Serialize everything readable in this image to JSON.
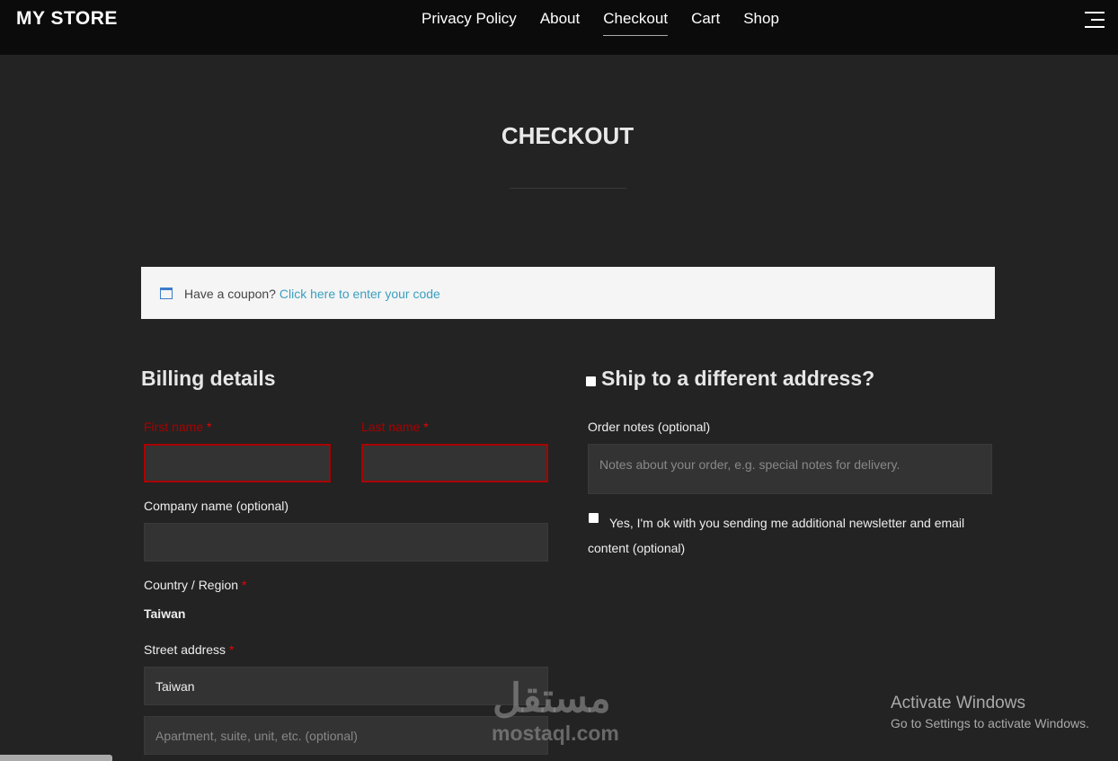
{
  "header": {
    "logo": "MY STORE",
    "nav": [
      "Privacy Policy",
      "About",
      "Checkout",
      "Cart",
      "Shop"
    ],
    "active": "Checkout"
  },
  "page_title": "CHECKOUT",
  "coupon": {
    "text": "Have a coupon?",
    "link": "Click here to enter your code"
  },
  "billing": {
    "title": "Billing details",
    "first_name": "First name",
    "last_name": "Last name",
    "required_mark": "*",
    "company": "Company name (optional)",
    "country_label": "Country / Region",
    "country_value": "Taiwan",
    "street_label": "Street address",
    "street_value": "Taiwan",
    "street2_placeholder": "Apartment, suite, unit, etc. (optional)"
  },
  "shipping": {
    "title": "Ship to a different address?",
    "notes_label": "Order notes (optional)",
    "notes_placeholder": "Notes about your order, e.g. special notes for delivery.",
    "newsletter": "Yes, I'm ok with you sending me additional newsletter and email content (optional)"
  },
  "watermark": {
    "arabic": "مستقل",
    "latin": "mostaql.com"
  },
  "activate": {
    "title": "Activate Windows",
    "sub": "Go to Settings to activate Windows."
  }
}
